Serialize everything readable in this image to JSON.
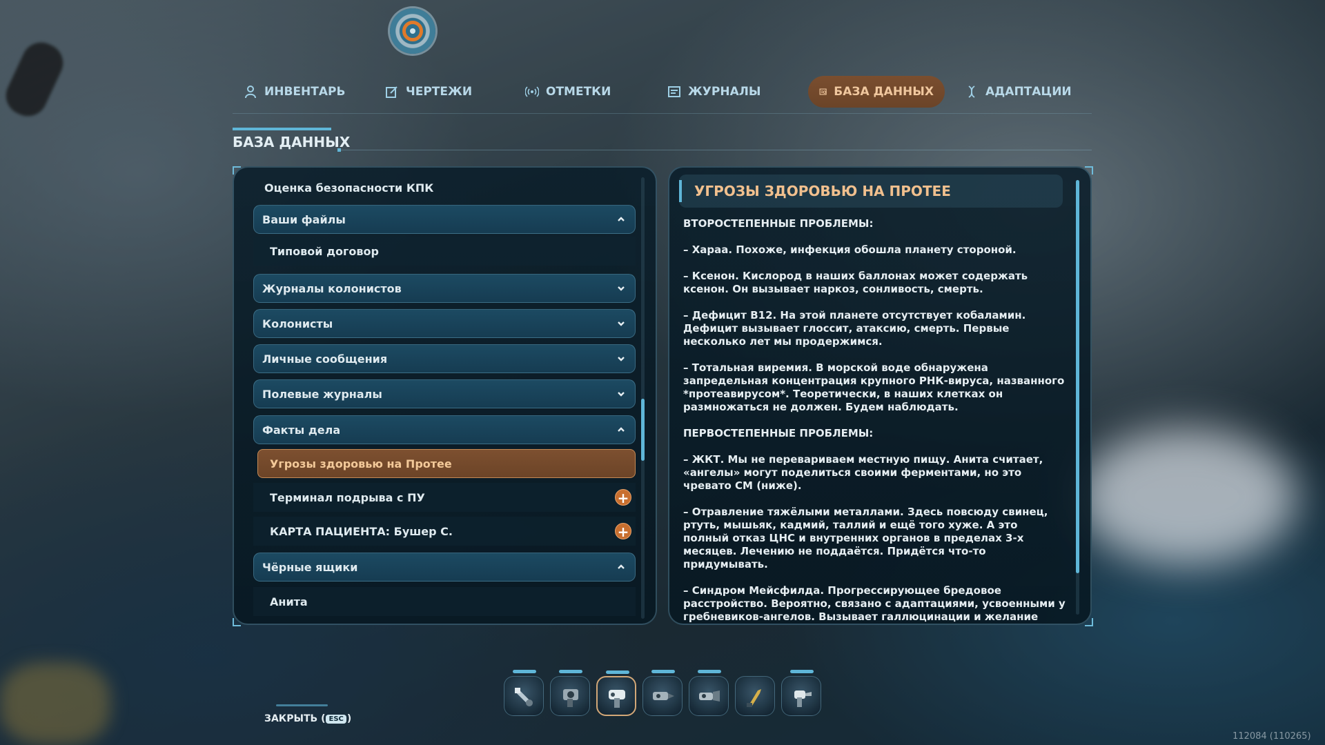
{
  "tabs": [
    {
      "label": "ИНВЕНТАРЬ",
      "icon": "person-icon"
    },
    {
      "label": "ЧЕРТЕЖИ",
      "icon": "blueprint-pencil-icon"
    },
    {
      "label": "ОТМЕТКИ",
      "icon": "signal-broadcast-icon"
    },
    {
      "label": "ЖУРНАЛЫ",
      "icon": "journal-icon"
    },
    {
      "label": "БАЗА ДАННЫХ",
      "icon": "database-icon",
      "active": true
    },
    {
      "label": "АДАПТАЦИИ",
      "icon": "dna-icon"
    }
  ],
  "section": {
    "title": "БАЗА ДАННЫХ"
  },
  "list": {
    "items": [
      {
        "label": "Оценка безопасности КПК",
        "kind": "plain"
      },
      {
        "label": "Ваши файлы",
        "kind": "category",
        "expanded": true
      },
      {
        "label": "Типовой договор",
        "kind": "sub"
      },
      {
        "label": "Журналы колонистов",
        "kind": "category",
        "expanded": false
      },
      {
        "label": "Колонисты",
        "kind": "category",
        "expanded": false
      },
      {
        "label": "Личные сообщения",
        "kind": "category",
        "expanded": false
      },
      {
        "label": "Полевые журналы",
        "kind": "category",
        "expanded": false
      },
      {
        "label": "Факты дела",
        "kind": "category",
        "expanded": true
      },
      {
        "label": "Угрозы здоровью на Протее",
        "kind": "selected"
      },
      {
        "label": "Терминал подрыва с ПУ",
        "kind": "sub",
        "new": true,
        "badge": "+"
      },
      {
        "label": "КАРТА ПАЦИЕНТА: Бушер С.",
        "kind": "sub",
        "new": true,
        "badge": "+"
      },
      {
        "label": "Чёрные ящики",
        "kind": "category",
        "expanded": true
      },
      {
        "label": "Анита",
        "kind": "sub"
      }
    ]
  },
  "article": {
    "title": "УГРОЗЫ ЗДОРОВЬЮ НА ПРОТЕЕ",
    "secondary_heading": "ВТОРОСТЕПЕННЫЕ ПРОБЛЕМЫ:",
    "secondary": [
      "– Хараа. Похоже, инфекция обошла планету стороной.",
      "– Ксенон. Кислород в наших баллонах может содержать ксенон. Он вызывает наркоз, сонливость, смерть.",
      "– Дефицит B12. На этой планете отсутствует кобаламин. Дефицит вызывает глоссит, атаксию, смерть. Первые несколько лет мы продержимся.",
      "– Тотальная виремия. В морской воде обнаружена запредельная концентрация крупного РНК-вируса, названного *протеавирусом*. Теоретически, в наших клетках он размножаться не должен. Будем наблюдать."
    ],
    "primary_heading": "ПЕРВОСТЕПЕННЫЕ ПРОБЛЕМЫ:",
    "primary": [
      "– ЖКТ. Мы не перевариваем местную пищу. Анита считает, «ангелы» могут поделиться своими ферментами, но это чревато СМ (ниже).",
      "– Отравление тяжёлыми металлами. Здесь повсюду свинец, ртуть, мышьяк, кадмий, таллий и ещё того хуже. А это полный отказ ЦНС и внутренних органов в пределах 3-х месяцев. Лечению не поддаётся. Придётся что-то придумывать.",
      "– Синдром Мейсфилда. Прогрессирующее бредовое расстройство. Вероятно, связано с адаптациями, усвоенными у гребневиков-ангелов. Вызывает галлюцинации и желание уплыть к тому здоровенному дереву. Единственное лечение – жёсткий сброс."
    ]
  },
  "hotbar": {
    "slots": [
      {
        "icon": "scanner-tool-icon",
        "has_tab": true
      },
      {
        "icon": "repair-tool-icon",
        "has_tab": true
      },
      {
        "icon": "builder-tool-icon",
        "has_tab": true,
        "active": true
      },
      {
        "icon": "drill-tool-icon",
        "has_tab": true
      },
      {
        "icon": "grapple-tool-icon",
        "has_tab": true
      },
      {
        "icon": "knife-tool-icon",
        "has_tab": false
      },
      {
        "icon": "spray-tool-icon",
        "has_tab": true
      }
    ]
  },
  "footer": {
    "close_label": "ЗАКРЫТЬ (",
    "close_key": "ESC",
    "close_suffix": ")"
  },
  "build": "112084 (110265)",
  "colors": {
    "accent": "#5fb6d8",
    "selected": "#7a4e2f",
    "highlight": "#f1c08e",
    "badge": "#c86f2f"
  }
}
